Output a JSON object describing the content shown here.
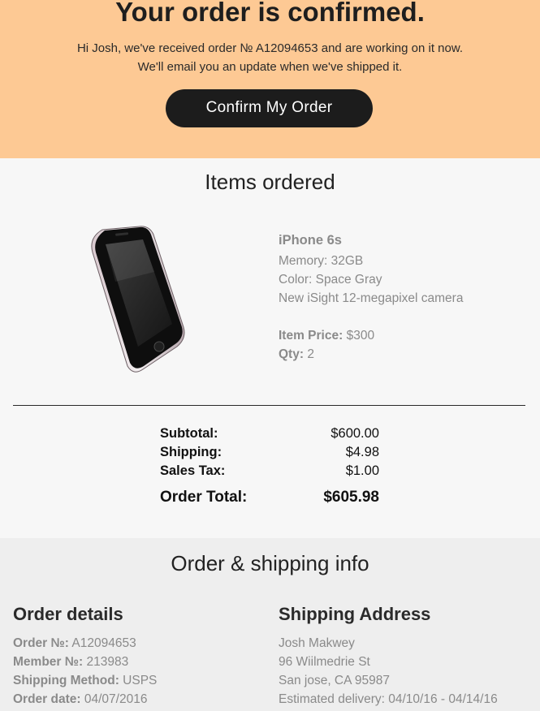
{
  "hero": {
    "title": "Your order is confirmed.",
    "message_line1": "Hi Josh, we've received order № A12094653 and are working on it now.",
    "message_line2": "We'll email you an update when we've shipped it.",
    "button_label": "Confirm My Order"
  },
  "items": {
    "heading": "Items ordered",
    "product": {
      "name": "iPhone 6s",
      "memory": "Memory: 32GB",
      "color": "Color: Space Gray",
      "feature": "New iSight 12-megapixel camera",
      "price_label": "Item Price:",
      "price_value": "$300",
      "qty_label": "Qty:",
      "qty_value": "2"
    }
  },
  "totals": {
    "subtotal_label": "Subtotal:",
    "subtotal_value": "$600.00",
    "shipping_label": "Shipping:",
    "shipping_value": "$4.98",
    "tax_label": "Sales Tax:",
    "tax_value": "$1.00",
    "total_label": "Order Total:",
    "total_value": "$605.98"
  },
  "shipping_info": {
    "heading": "Order & shipping info",
    "order_details": {
      "heading": "Order details",
      "order_no_label": "Order №:",
      "order_no_value": "A12094653",
      "member_no_label": "Member №:",
      "member_no_value": "213983",
      "method_label": "Shipping Method:",
      "method_value": "USPS",
      "date_label": "Order date:",
      "date_value": "04/07/2016"
    },
    "address": {
      "heading": "Shipping Address",
      "name": "Josh Makwey",
      "street": "96 Wiilmedrie St",
      "city": "San jose, CA 95987",
      "estimated": "Estimated delivery: 04/10/16 - 04/14/16"
    }
  },
  "colors": {
    "hero_bg": "#fdc994",
    "button_bg": "#1c1c1c",
    "items_bg": "#f7f7f7",
    "ship_bg": "#eeeeee",
    "muted_text": "#8a8a8a"
  },
  "icons": {
    "product_image": "iphone-image"
  }
}
